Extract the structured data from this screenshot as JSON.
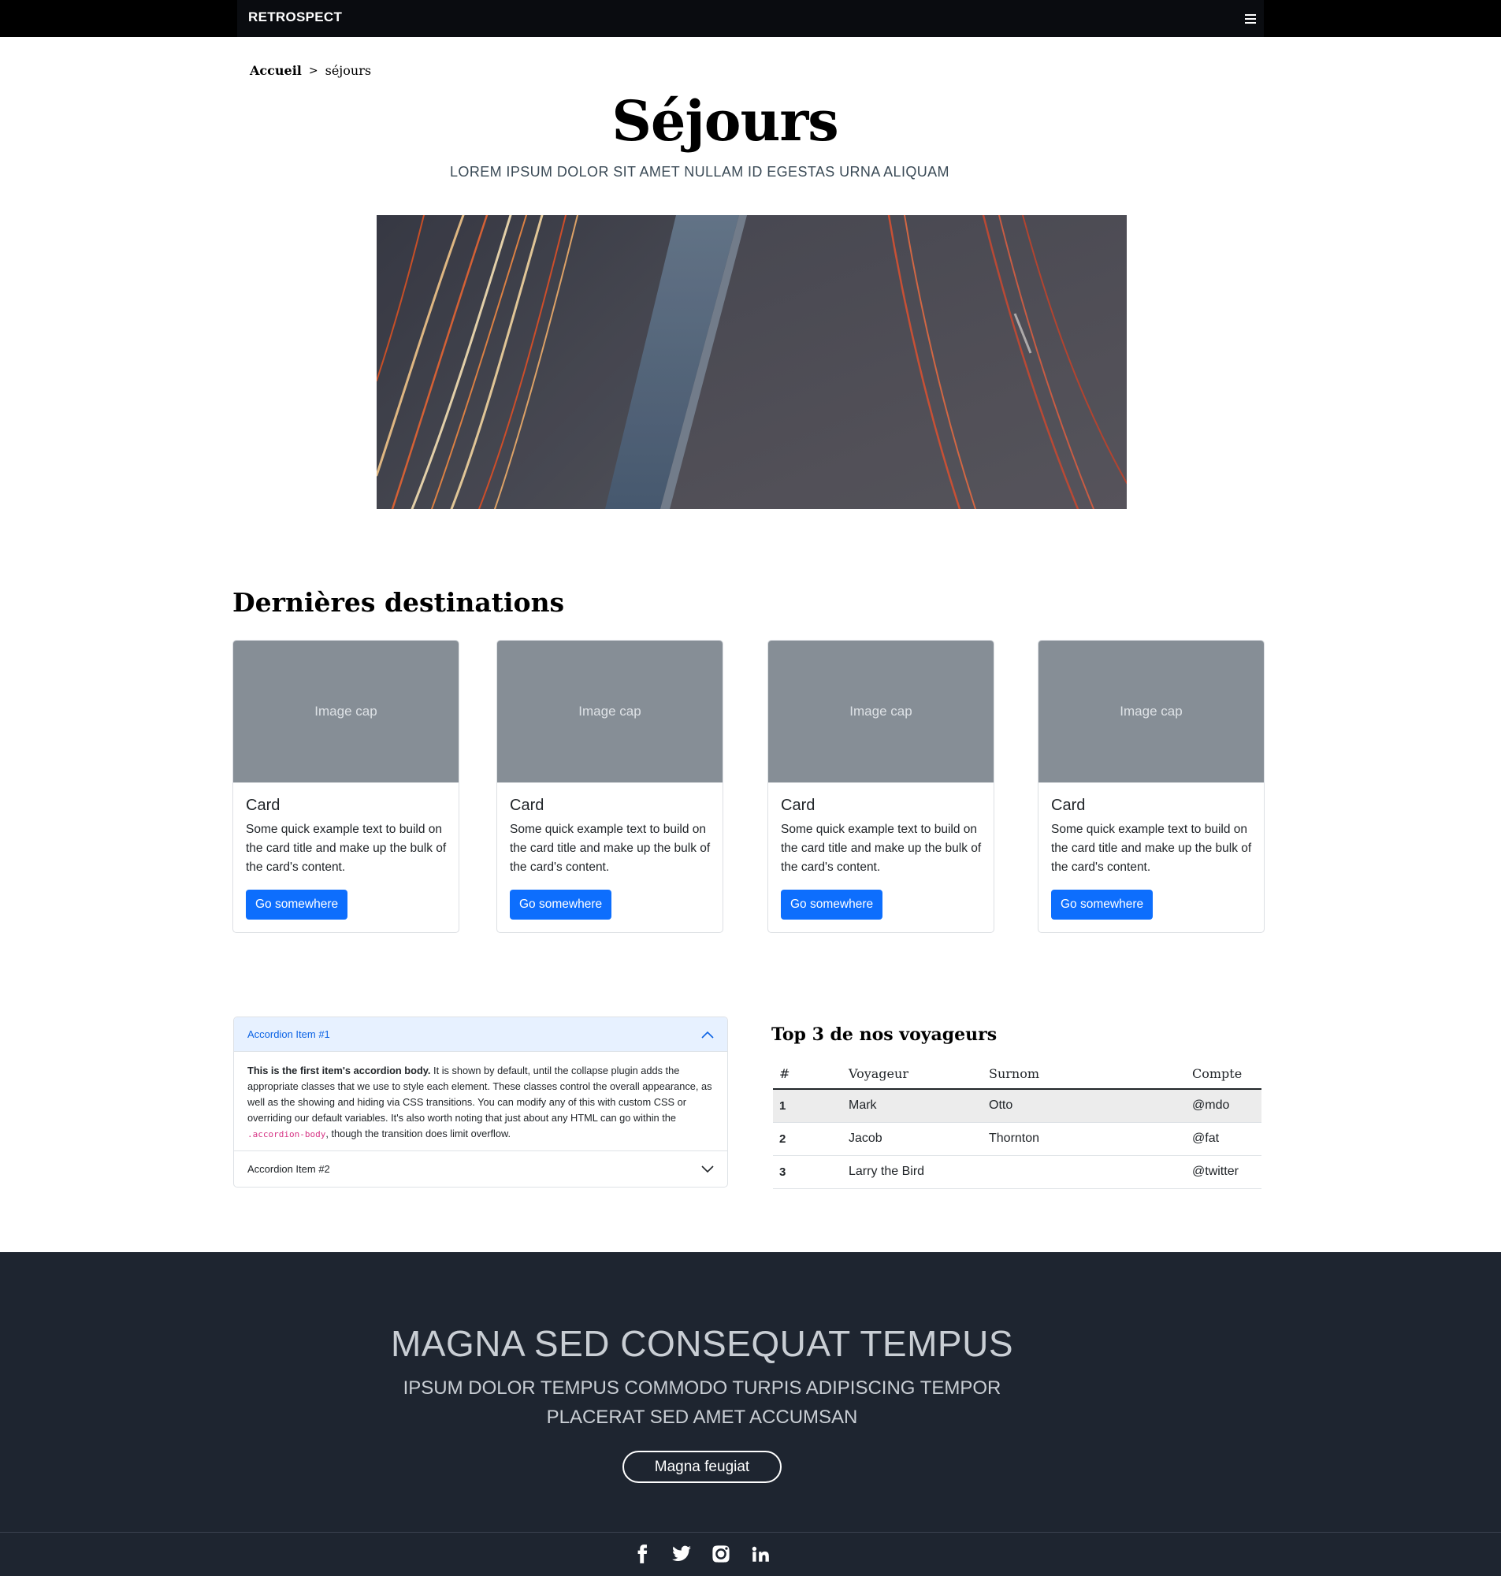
{
  "header": {
    "brand": "RETROSPECT",
    "menu_icon": "hamburger-icon"
  },
  "breadcrumb": {
    "home": "Accueil",
    "separator": ">",
    "current": "séjours"
  },
  "page": {
    "title": "Séjours",
    "subtitle": "LOREM IPSUM DOLOR SIT AMET NULLAM ID EGESTAS URNA ALIQUAM"
  },
  "destinations": {
    "heading": "Dernières destinations",
    "cards": [
      {
        "cap": "Image cap",
        "title": "Card",
        "text": "Some quick example text to build on the card title and make up the bulk of the card's content.",
        "button": "Go somewhere"
      },
      {
        "cap": "Image cap",
        "title": "Card",
        "text": "Some quick example text to build on the card title and make up the bulk of the card's content.",
        "button": "Go somewhere"
      },
      {
        "cap": "Image cap",
        "title": "Card",
        "text": "Some quick example text to build on the card title and make up the bulk of the card's content.",
        "button": "Go somewhere"
      },
      {
        "cap": "Image cap",
        "title": "Card",
        "text": "Some quick example text to build on the card title and make up the bulk of the card's content.",
        "button": "Go somewhere"
      }
    ]
  },
  "accordion": {
    "item1": {
      "label": "Accordion Item #1",
      "body_strong": "This is the first item's accordion body.",
      "body_text": " It is shown by default, until the collapse plugin adds the appropriate classes that we use to style each element. These classes control the overall appearance, as well as the showing and hiding via CSS transitions. You can modify any of this with custom CSS or overriding our default variables. It's also worth noting that just about any HTML can go within the ",
      "body_code": ".accordion-body",
      "body_tail": ", though the transition does limit overflow."
    },
    "item2": {
      "label": "Accordion Item #2"
    }
  },
  "travelers": {
    "title": "Top 3 de nos voyageurs",
    "headers": [
      "#",
      "Voyageur",
      "Surnom",
      "Compte"
    ],
    "rows": [
      [
        "1",
        "Mark",
        "Otto",
        "@mdo"
      ],
      [
        "2",
        "Jacob",
        "Thornton",
        "@fat"
      ],
      [
        "3",
        "Larry the Bird",
        "",
        "@twitter"
      ]
    ]
  },
  "footer": {
    "headline": "MAGNA SED CONSEQUAT TEMPUS",
    "subline": "IPSUM DOLOR TEMPUS COMMODO TURPIS ADIPISCING TEMPOR PLACERAT SED AMET ACCUMSAN",
    "cta": "Magna feugiat",
    "social": [
      "facebook-icon",
      "twitter-icon",
      "instagram-icon",
      "linkedin-icon"
    ]
  },
  "colors": {
    "primary": "#0d6efd",
    "footer_bg": "#1e2530",
    "navbar_bg": "#000000"
  }
}
